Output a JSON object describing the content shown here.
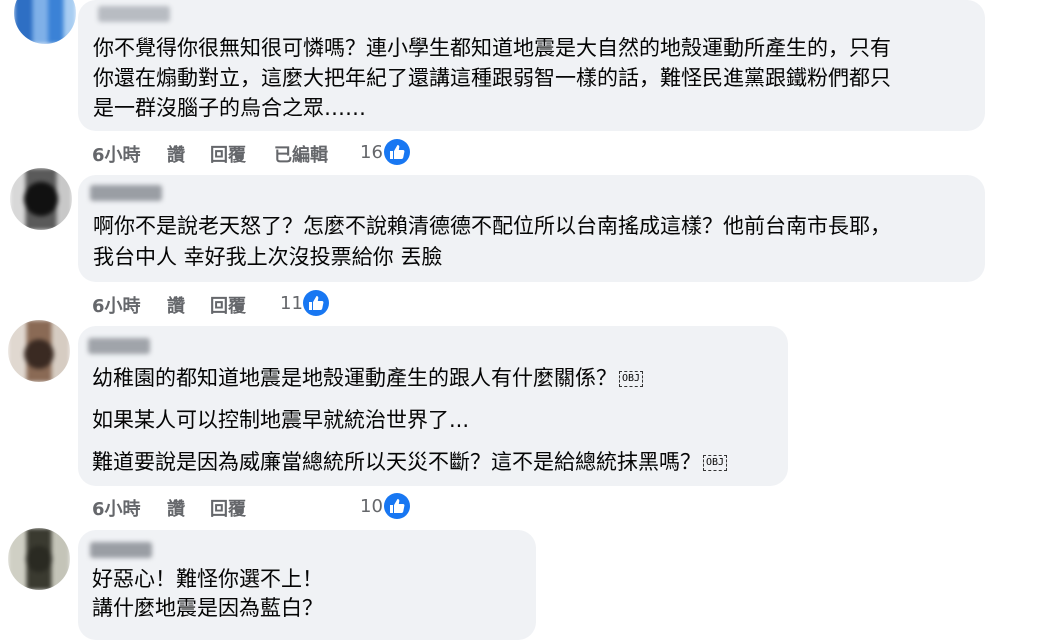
{
  "comments": [
    {
      "lines": [
        "你不覺得你很無知很可憐嗎？連小學生都知道地震是大自然的地殼運動所產生的，只有",
        "你還在煽動對立，這麼大把年紀了還講這種跟弱智一樣的話，難怪民進黨跟鐵粉們都只",
        "是一群沒腦子的烏合之眾……"
      ],
      "time": "6小時",
      "like_label": "讚",
      "reply_label": "回覆",
      "edited_label": "已編輯",
      "reactions": "16",
      "avatar_color": "#4a8fd8"
    },
    {
      "lines": [
        "啊你不是說老天怒了？怎麼不說賴清德德不配位所以台南搖成這樣？他前台南市長耶，",
        "我台中人 幸好我上次沒投票給你 丟臉"
      ],
      "time": "6小時",
      "like_label": "讚",
      "reply_label": "回覆",
      "reactions": "11",
      "avatar_color": "#1a1a1a"
    },
    {
      "lines": [
        "幼稚園的都知道地震是地殼運動產生的跟人有什麼關係？",
        "如果某人可以控制地震早就統治世界了...",
        "難道要說是因為威廉當總統所以天災不斷？這不是給總統抹黑嗎？"
      ],
      "obj_marker": "OBJ",
      "time": "6小時",
      "like_label": "讚",
      "reply_label": "回覆",
      "reactions": "10",
      "avatar_color": "#8a6a55"
    },
    {
      "lines": [
        "好惡心！難怪你選不上！",
        "講什麼地震是因為藍白？"
      ],
      "avatar_color": "#3a3a30"
    }
  ],
  "colors": {
    "bubble_bg": "#f0f2f5",
    "meta_text": "#65676b",
    "like_blue": "#1877f2"
  },
  "icons": {
    "reaction": "thumbs-up-icon"
  }
}
